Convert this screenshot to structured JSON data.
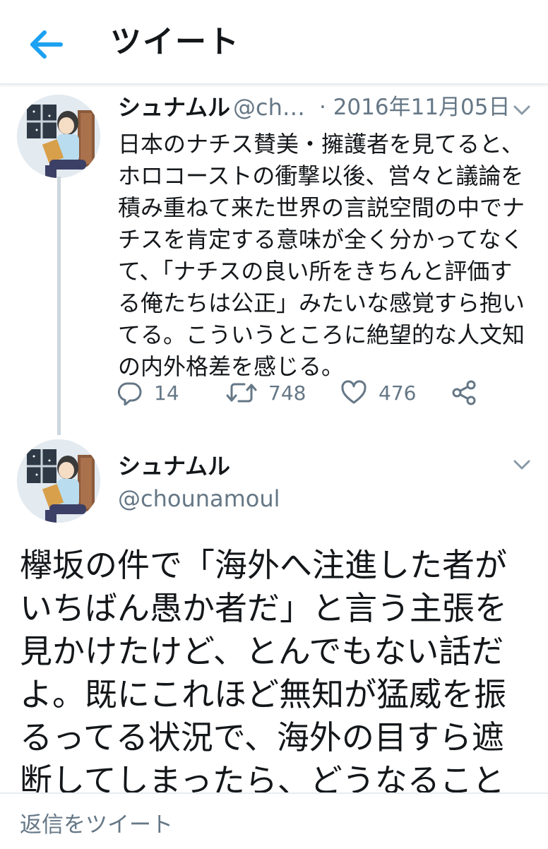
{
  "header": {
    "title": "ツイート",
    "back_icon": "arrow-left-icon"
  },
  "colors": {
    "accent": "#1da1f2",
    "muted": "#657786",
    "divider": "#e6ecf0",
    "thread_line": "#ccd6dd"
  },
  "tweet1": {
    "name": "シュナムル",
    "handle": "@ch…",
    "date": "· 2016年11月05日",
    "text": "日本のナチス賛美・擁護者を見てると、\nホロコーストの衝撃以後、営々と議論を\n積み重ねて来た世界の言説空間の中でナ\nチスを肯定する意味が全く分かってなく\nて、「ナチスの良い所をきちんと評価す\nる俺たちは公正」みたいな感覚すら抱い\nてる。こういうところに絶望的な人文知\nの内外格差を感じる。",
    "actions": {
      "replies": "14",
      "retweets": "748",
      "likes": "476"
    }
  },
  "tweet2": {
    "name": "シュナムル",
    "handle": "@chounamoul",
    "text": "欅坂の件で「海外へ注進した者が\nいちばん愚か者だ」と言う主張を\n見かけたけど、とんでもない話だ\nよ。既にこれほど無知が猛威を振\nるってる状況で、海外の目すら遮\n断してしまったら、どうなること"
  },
  "reply_bar": {
    "placeholder": "返信をツイート"
  }
}
